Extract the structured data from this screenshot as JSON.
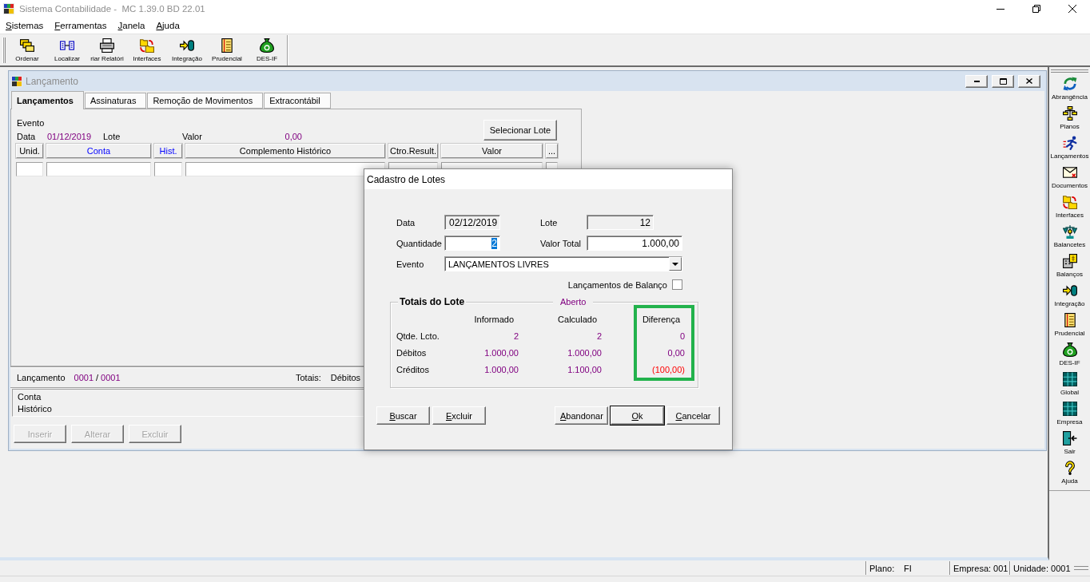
{
  "window": {
    "title": "Sistema Contabilidade -  MC 1.39.0 BD 22.01"
  },
  "menu": [
    "Sistemas",
    "Ferramentas",
    "Janela",
    "Ajuda"
  ],
  "toolbar": [
    {
      "label": "Ordenar",
      "kind": "stack"
    },
    {
      "label": "Localizar",
      "kind": "boxes"
    },
    {
      "label": "riar Relatóri",
      "kind": "printer"
    },
    {
      "label": "Interfaces",
      "kind": "folders"
    },
    {
      "label": "Integração",
      "kind": "cylinder"
    },
    {
      "label": "Prudencial",
      "kind": "notebook"
    },
    {
      "label": "DES-IF",
      "kind": "moneybag"
    }
  ],
  "child_window": {
    "title": "Lançamento",
    "tabs": [
      {
        "label": "Lançamentos",
        "selected": true
      },
      {
        "label": "Assinaturas",
        "selected": false
      },
      {
        "label": "Remoção de Movimentos",
        "selected": false
      },
      {
        "label": "Extracontábil",
        "selected": false
      }
    ],
    "evento_label": "Evento",
    "data_label": "Data",
    "data_value": "01/12/2019",
    "lote_label": "Lote",
    "valor_label": "Valor",
    "valor_value": "0,00",
    "select_button": "Selecionar Lote",
    "grid_columns": [
      {
        "label": "Unid.",
        "lookup": false
      },
      {
        "label": "Conta",
        "lookup": true
      },
      {
        "label": "Hist.",
        "lookup": true
      },
      {
        "label": "Complemento Histórico",
        "lookup": false
      },
      {
        "label": "Ctro.Result.",
        "lookup": false
      },
      {
        "label": "Valor",
        "lookup": false
      },
      {
        "label": "...",
        "lookup": false
      }
    ],
    "footer": {
      "label": "Lançamento",
      "current": "0001",
      "separator": "/",
      "total": "0001",
      "totals_label": "Totais:",
      "debitos_label": "Débitos"
    },
    "info_panel": [
      "Conta",
      "Histórico"
    ],
    "buttons": [
      {
        "label": "Inserir",
        "disabled": true
      },
      {
        "label": "Alterar",
        "disabled": true
      },
      {
        "label": "Excluir",
        "disabled": true
      }
    ]
  },
  "dialog": {
    "title": "Cadastro de Lotes",
    "fields": [
      {
        "label": "Data",
        "kind": "date",
        "value": "02/12/2019",
        "readonly": true,
        "text_selected": false
      },
      {
        "label": "Lote",
        "kind": "number",
        "value": "12",
        "readonly": true,
        "text_selected": false
      },
      {
        "label": "Quantidade",
        "kind": "number",
        "value": "2",
        "readonly": false,
        "text_selected": true
      },
      {
        "label": "Valor Total",
        "kind": "number",
        "value": "1.000,00",
        "readonly": false,
        "text_selected": false
      }
    ],
    "evento": {
      "label": "Evento",
      "value": "LANÇAMENTOS LIVRES"
    },
    "balanco_checkbox": {
      "label": "Lançamentos de Balanço",
      "checked": false
    },
    "totals": {
      "title": "Totais do Lote",
      "status": "Aberto",
      "columns": [
        {
          "header": "Informado",
          "highlighted": false
        },
        {
          "header": "Calculado",
          "highlighted": false
        },
        {
          "header": "Diferença",
          "highlighted": true
        }
      ],
      "rows": [
        {
          "label": "Qtde. Lcto.",
          "cells": [
            {
              "text": "2",
              "negative": false
            },
            {
              "text": "2",
              "negative": false
            },
            {
              "text": "0",
              "negative": false
            }
          ]
        },
        {
          "label": "Débitos",
          "cells": [
            {
              "text": "1.000,00",
              "negative": false
            },
            {
              "text": "1.000,00",
              "negative": false
            },
            {
              "text": "0,00",
              "negative": false
            }
          ]
        },
        {
          "label": "Créditos",
          "cells": [
            {
              "text": "1.000,00",
              "negative": false
            },
            {
              "text": "1.100,00",
              "negative": false
            },
            {
              "text": "(100,00)",
              "negative": true
            }
          ]
        }
      ]
    },
    "buttons_left": [
      {
        "label": "Buscar",
        "default": false
      },
      {
        "label": "Excluir",
        "default": false
      }
    ],
    "buttons_right": [
      {
        "label": "Abandonar",
        "default": false
      },
      {
        "label": "Ok",
        "default": true
      },
      {
        "label": "Cancelar",
        "default": false
      }
    ]
  },
  "sidebar": [
    {
      "label": "Abrangência",
      "kind": "refresh"
    },
    {
      "label": "Planos",
      "kind": "orgchart"
    },
    {
      "label": "Lançamentos",
      "kind": "runner"
    },
    {
      "label": "Documentos",
      "kind": "envelope"
    },
    {
      "label": "Interfaces",
      "kind": "folders"
    },
    {
      "label": "Balancetes",
      "kind": "scale"
    },
    {
      "label": "Balanços",
      "kind": "building"
    },
    {
      "label": "Integração",
      "kind": "cylinder"
    },
    {
      "label": "Prudencial",
      "kind": "notebook"
    },
    {
      "label": "DES-IF",
      "kind": "moneybag"
    },
    {
      "label": "Global",
      "kind": "grid"
    },
    {
      "label": "Empresa",
      "kind": "grid"
    },
    {
      "label": "Sair",
      "kind": "door"
    },
    {
      "label": "Ajuda",
      "kind": "question"
    }
  ],
  "status_bar": [
    {
      "label": "Plano:",
      "value": "FI"
    },
    {
      "label": "Empresa:",
      "value": "001"
    },
    {
      "label": "Unidade:",
      "value": "0001"
    }
  ]
}
